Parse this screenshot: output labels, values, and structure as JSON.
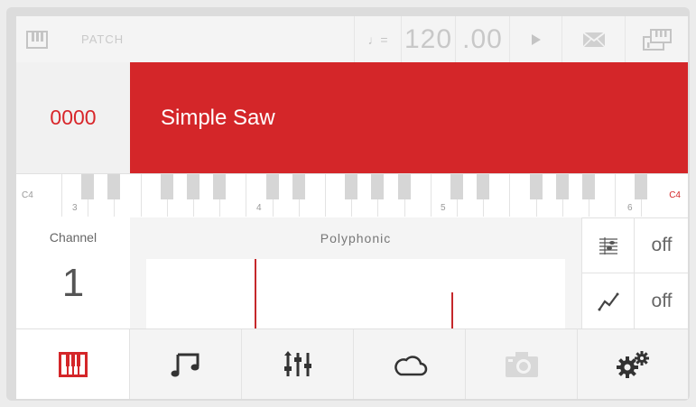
{
  "topbar": {
    "patch_label": "PATCH",
    "tempo_symbol": "♩=",
    "tempo_value": "120",
    "tempo_decimal": ".00"
  },
  "patch": {
    "number": "0000",
    "name": "Simple Saw"
  },
  "keyboard": {
    "left_note": "C4",
    "right_note": "C4",
    "octave_markers": [
      "3",
      "4",
      "5",
      "6"
    ]
  },
  "channel": {
    "label": "Channel",
    "value": "1"
  },
  "voice_mode": "Polyphonic",
  "toggles": [
    {
      "icon": "arpeggiator-icon",
      "value": "off"
    },
    {
      "icon": "glide-curve-icon",
      "value": "off"
    }
  ],
  "bottom_nav": [
    {
      "icon": "keyboard-icon",
      "active": true
    },
    {
      "icon": "music-notes-icon",
      "active": false
    },
    {
      "icon": "mixer-sliders-icon",
      "active": false
    },
    {
      "icon": "cloud-icon",
      "active": false
    },
    {
      "icon": "camera-icon",
      "active": false,
      "disabled": true
    },
    {
      "icon": "settings-gears-icon",
      "active": false
    }
  ],
  "colors": {
    "accent": "#d42629",
    "accent_text": "#d8262a",
    "muted": "#c4c4c4"
  }
}
